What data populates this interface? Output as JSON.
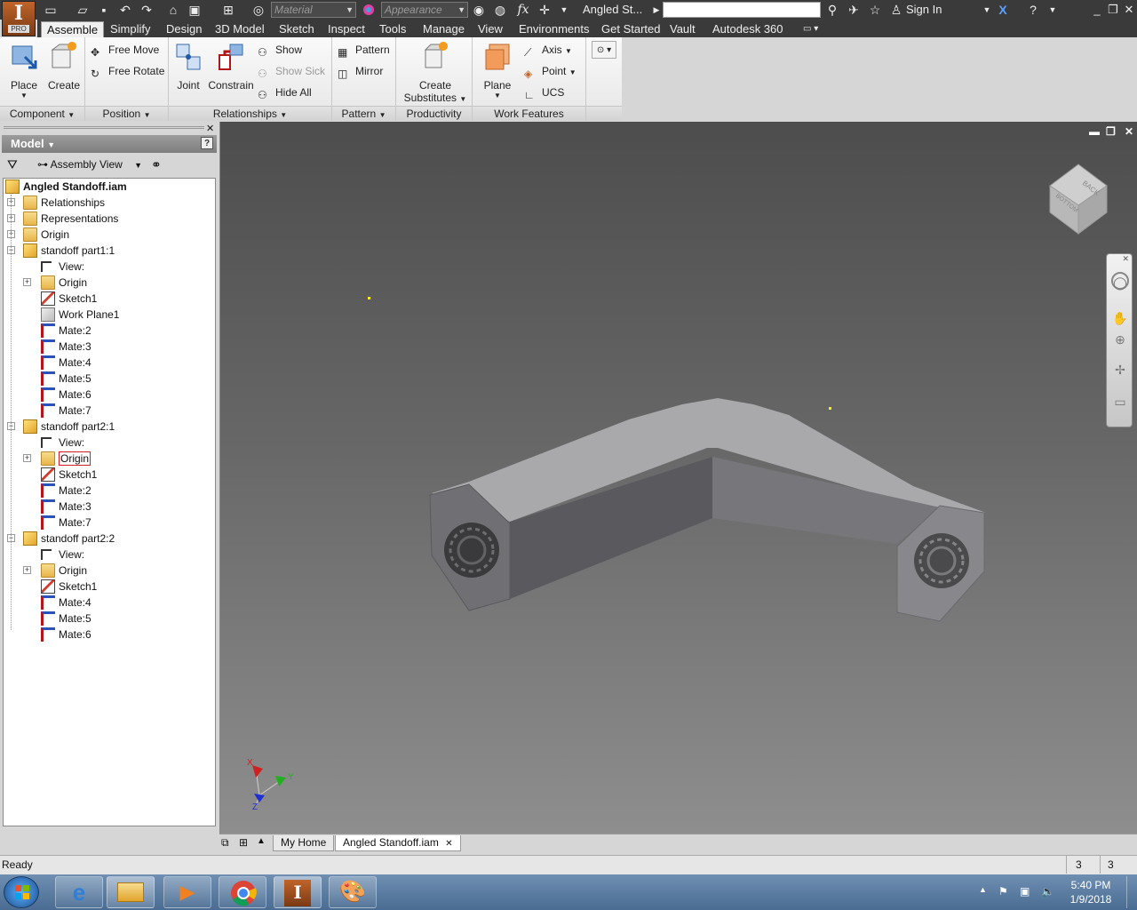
{
  "titlebar": {
    "logo_text": "I",
    "logo_sub": "PRO",
    "material_placeholder": "Material",
    "appearance_placeholder": "Appearance",
    "doc_title": "Angled St...",
    "sign_in": "Sign In",
    "fx": "fx"
  },
  "tabs": [
    "Assemble",
    "Simplify",
    "Design",
    "3D Model",
    "Sketch",
    "Inspect",
    "Tools",
    "Manage",
    "View",
    "Environments",
    "Get Started",
    "Vault",
    "Autodesk 360"
  ],
  "ribbon": {
    "component": {
      "title": "Component",
      "place": "Place",
      "create": "Create"
    },
    "position": {
      "title": "Position",
      "free_move": "Free Move",
      "free_rotate": "Free Rotate"
    },
    "relationships": {
      "title": "Relationships",
      "joint": "Joint",
      "constrain": "Constrain",
      "show": "Show",
      "show_sick": "Show Sick",
      "hide_all": "Hide All"
    },
    "pattern": {
      "title": "Pattern",
      "pattern": "Pattern",
      "mirror": "Mirror"
    },
    "productivity": {
      "title": "Productivity",
      "create_substitutes_1": "Create",
      "create_substitutes_2": "Substitutes"
    },
    "work_features": {
      "title": "Work Features",
      "plane": "Plane",
      "axis": "Axis",
      "point": "Point",
      "ucs": "UCS"
    }
  },
  "browser": {
    "header": "Model",
    "view_label": "Assembly View",
    "tree": [
      {
        "label": "Angled Standoff.iam",
        "level": 0,
        "icon": "assembly",
        "exp": "",
        "bold": true
      },
      {
        "label": "Relationships",
        "level": 1,
        "icon": "folder",
        "exp": "+"
      },
      {
        "label": "Representations",
        "level": 1,
        "icon": "representations",
        "exp": "+"
      },
      {
        "label": "Origin",
        "level": 1,
        "icon": "folder",
        "exp": "+"
      },
      {
        "label": "standoff part1:1",
        "level": 1,
        "icon": "part",
        "exp": "-"
      },
      {
        "label": "View:",
        "level": 2,
        "icon": "view",
        "exp": ""
      },
      {
        "label": "Origin",
        "level": 2,
        "icon": "folder",
        "exp": "+"
      },
      {
        "label": "Sketch1",
        "level": 2,
        "icon": "sketch",
        "exp": ""
      },
      {
        "label": "Work Plane1",
        "level": 2,
        "icon": "workplane",
        "exp": ""
      },
      {
        "label": "Mate:2",
        "level": 2,
        "icon": "mate",
        "exp": ""
      },
      {
        "label": "Mate:3",
        "level": 2,
        "icon": "mate",
        "exp": ""
      },
      {
        "label": "Mate:4",
        "level": 2,
        "icon": "mate",
        "exp": ""
      },
      {
        "label": "Mate:5",
        "level": 2,
        "icon": "mate",
        "exp": ""
      },
      {
        "label": "Mate:6",
        "level": 2,
        "icon": "mate",
        "exp": ""
      },
      {
        "label": "Mate:7",
        "level": 2,
        "icon": "mate",
        "exp": ""
      },
      {
        "label": "standoff part2:1",
        "level": 1,
        "icon": "part",
        "exp": "-"
      },
      {
        "label": "View:",
        "level": 2,
        "icon": "view",
        "exp": ""
      },
      {
        "label": "Origin",
        "level": 2,
        "icon": "folder",
        "exp": "+",
        "selected": true
      },
      {
        "label": "Sketch1",
        "level": 2,
        "icon": "sketch",
        "exp": ""
      },
      {
        "label": "Mate:2",
        "level": 2,
        "icon": "mate",
        "exp": ""
      },
      {
        "label": "Mate:3",
        "level": 2,
        "icon": "mate",
        "exp": ""
      },
      {
        "label": "Mate:7",
        "level": 2,
        "icon": "mate",
        "exp": ""
      },
      {
        "label": "standoff part2:2",
        "level": 1,
        "icon": "part",
        "exp": "-"
      },
      {
        "label": "View:",
        "level": 2,
        "icon": "view",
        "exp": ""
      },
      {
        "label": "Origin",
        "level": 2,
        "icon": "folder",
        "exp": "+"
      },
      {
        "label": "Sketch1",
        "level": 2,
        "icon": "sketch",
        "exp": ""
      },
      {
        "label": "Mate:4",
        "level": 2,
        "icon": "mate",
        "exp": ""
      },
      {
        "label": "Mate:5",
        "level": 2,
        "icon": "mate",
        "exp": ""
      },
      {
        "label": "Mate:6",
        "level": 2,
        "icon": "mate",
        "exp": ""
      }
    ]
  },
  "viewcube": {
    "face_top": "BACK",
    "face_front": "BOTTOM"
  },
  "triad": {
    "x": "X",
    "y": "Y",
    "z": "Z"
  },
  "doctabs": {
    "home": "My Home",
    "doc": "Angled Standoff.iam"
  },
  "status": {
    "text": "Ready",
    "count1": "3",
    "count2": "3"
  },
  "clock": {
    "time": "5:40 PM",
    "date": "1/9/2018"
  },
  "colors": {
    "accent": "#c0642a",
    "viewport_top": "#4d4d4d",
    "viewport_bottom": "#8e8e8e",
    "mate_red": "#b01818"
  }
}
